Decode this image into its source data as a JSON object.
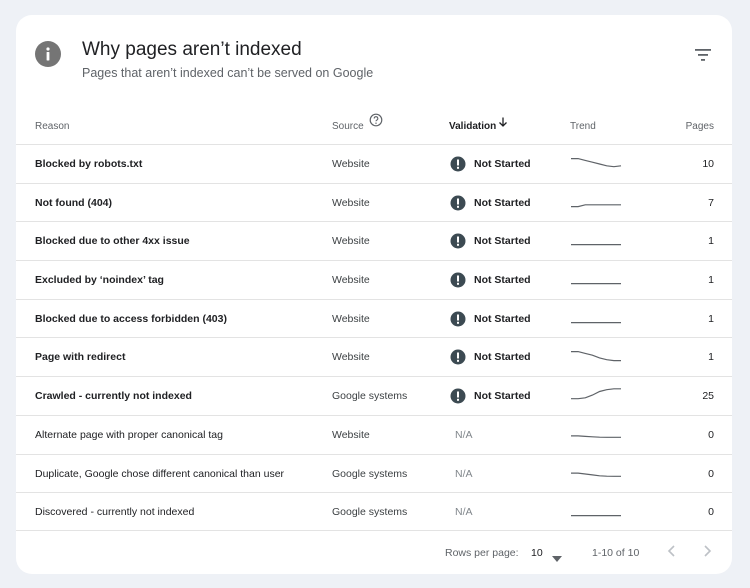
{
  "header": {
    "title": "Why pages aren’t indexed",
    "subtitle": "Pages that aren’t indexed can’t be served on Google",
    "info_icon": "info-icon",
    "filter_icon": "filter-icon"
  },
  "table": {
    "columns": {
      "reason": "Reason",
      "source": "Source",
      "validation": "Validation",
      "trend": "Trend",
      "pages": "Pages"
    },
    "sort_icon": "arrow-down-icon",
    "help_icon": "help-icon",
    "rows": [
      {
        "reason": "Blocked by robots.txt",
        "source": "Website",
        "validation": "Not Started",
        "pages": "10",
        "trend": [
          0.8,
          0.8,
          0.7,
          0.6,
          0.5,
          0.4,
          0.35,
          0.4
        ]
      },
      {
        "reason": "Not found (404)",
        "source": "Website",
        "validation": "Not Started",
        "pages": "7",
        "trend": [
          0.3,
          0.3,
          0.4,
          0.4,
          0.4,
          0.4,
          0.4,
          0.4
        ]
      },
      {
        "reason": "Blocked due to other 4xx issue",
        "source": "Website",
        "validation": "Not Started",
        "pages": "1",
        "trend": [
          0.3,
          0.3,
          0.3,
          0.3,
          0.3,
          0.3,
          0.3,
          0.3
        ]
      },
      {
        "reason": "Excluded by ‘noindex’ tag",
        "source": "Website",
        "validation": "Not Started",
        "pages": "1",
        "trend": [
          0.3,
          0.3,
          0.3,
          0.3,
          0.3,
          0.3,
          0.3,
          0.3
        ]
      },
      {
        "reason": "Blocked due to access forbidden (403)",
        "source": "Website",
        "validation": "Not Started",
        "pages": "1",
        "trend": [
          0.3,
          0.3,
          0.3,
          0.3,
          0.3,
          0.3,
          0.3,
          0.3
        ]
      },
      {
        "reason": "Page with redirect",
        "source": "Website",
        "validation": "Not Started",
        "pages": "1",
        "trend": [
          0.8,
          0.8,
          0.7,
          0.6,
          0.45,
          0.35,
          0.3,
          0.3
        ]
      },
      {
        "reason": "Crawled - currently not indexed",
        "source": "Google systems",
        "validation": "Not Started",
        "pages": "25",
        "trend": [
          0.35,
          0.35,
          0.4,
          0.55,
          0.75,
          0.85,
          0.9,
          0.9
        ]
      },
      {
        "reason": "Alternate page with proper canonical tag",
        "source": "Website",
        "validation": "N/A",
        "pages": "0",
        "trend": [
          0.45,
          0.45,
          0.42,
          0.4,
          0.38,
          0.37,
          0.37,
          0.37
        ]
      },
      {
        "reason": "Duplicate, Google chose different canonical than user",
        "source": "Google systems",
        "validation": "N/A",
        "pages": "0",
        "trend": [
          0.55,
          0.55,
          0.5,
          0.45,
          0.4,
          0.38,
          0.37,
          0.37
        ]
      },
      {
        "reason": "Discovered - currently not indexed",
        "source": "Google systems",
        "validation": "N/A",
        "pages": "0",
        "trend": [
          0.3,
          0.3,
          0.3,
          0.3,
          0.3,
          0.3,
          0.3,
          0.3
        ]
      }
    ]
  },
  "footer": {
    "rows_per_page_label": "Rows per page:",
    "rows_per_page_value": "10",
    "range": "1-10 of 10",
    "prev_icon": "chevron-left-icon",
    "next_icon": "chevron-right-icon"
  },
  "colors": {
    "status_icon": "#3c4a52",
    "trend_line": "#5f6368"
  }
}
